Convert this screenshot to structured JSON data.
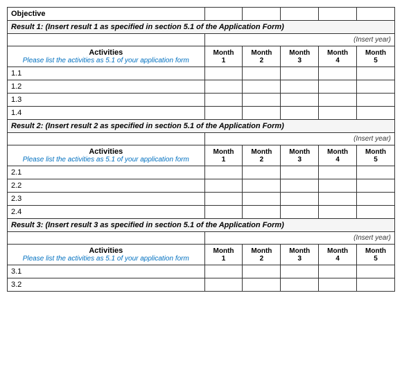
{
  "table": {
    "objective_label": "Objective",
    "insert_year": "(Insert year)",
    "activities_label": "Activities",
    "activities_italic": "Please list the activities as 5.1 of your application form",
    "months": [
      {
        "label": "Month",
        "number": "1"
      },
      {
        "label": "Month",
        "number": "2"
      },
      {
        "label": "Month",
        "number": "3"
      },
      {
        "label": "Month",
        "number": "4"
      },
      {
        "label": "Month",
        "number": "5"
      }
    ],
    "results": [
      {
        "header": "Result 1:  (Insert result 1 as  specified in section 5.1 of the Application Form)",
        "rows": [
          "1.1",
          "1.2",
          "1.3",
          "1.4"
        ]
      },
      {
        "header": "Result 2:  (Insert result 2 as specified in section 5.1 of the Application Form)",
        "rows": [
          "2.1",
          "2.2",
          "2.3",
          "2.4"
        ]
      },
      {
        "header": "Result 3:  (Insert result 3 as specified in section 5.1 of the Application Form)",
        "rows": [
          "3.1",
          "3.2"
        ]
      }
    ]
  }
}
